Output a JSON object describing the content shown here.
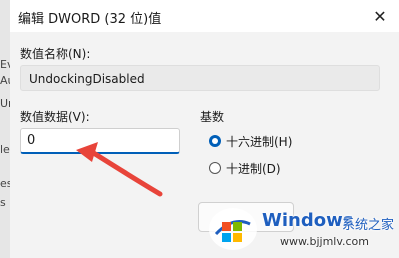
{
  "background": {
    "fragments": [
      "Ev",
      "Au",
      "Ur",
      "le",
      "es",
      "s"
    ]
  },
  "dialog": {
    "title": "编辑 DWORD (32 位)值",
    "close_glyph": "✕",
    "value_name_label": "数值名称(N):",
    "value_name": "UndockingDisabled",
    "value_data_label": "数值数据(V):",
    "value_data": "0",
    "base": {
      "label": "基数",
      "options": [
        {
          "label": "十六进制(H)",
          "checked": true
        },
        {
          "label": "十进制(D)",
          "checked": false
        }
      ]
    }
  },
  "annotation": {
    "arrow_color": "#e8443a"
  },
  "watermark": {
    "title": "Windows",
    "subtitle": "系统之家",
    "url": "www.bjjmlv.com"
  },
  "colors": {
    "accent": "#005fb8",
    "watermark_blue": "#1f5fbf"
  }
}
